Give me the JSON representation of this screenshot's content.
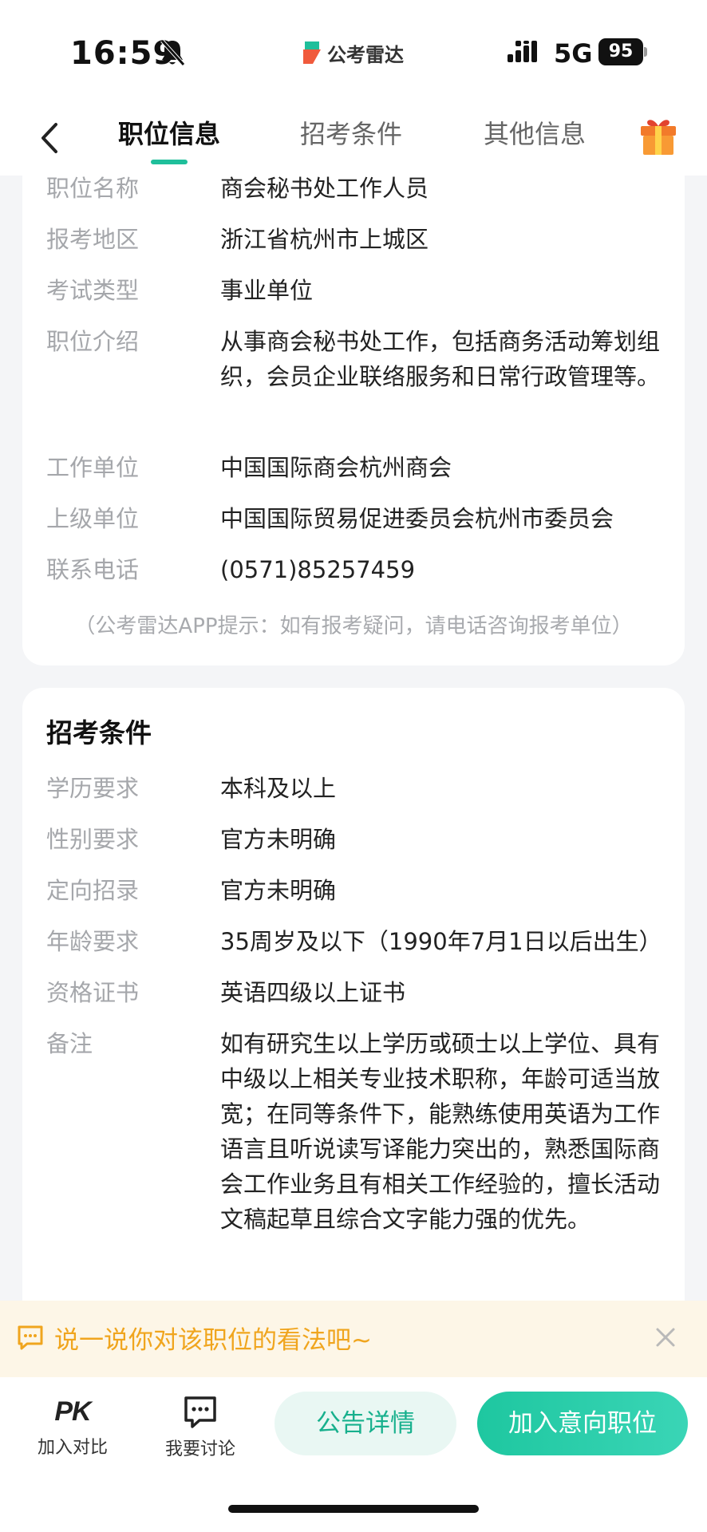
{
  "status_bar": {
    "time": "16:59",
    "network": "5G",
    "battery": "95",
    "app_logo_text": "公考雷达"
  },
  "nav": {
    "tabs": [
      {
        "label": "职位信息",
        "active": true
      },
      {
        "label": "招考条件",
        "active": false
      },
      {
        "label": "其他信息",
        "active": false
      }
    ]
  },
  "position_info": {
    "rows": [
      {
        "label": "职位名称",
        "value": "商会秘书处工作人员"
      },
      {
        "label": "报考地区",
        "value": "浙江省杭州市上城区"
      },
      {
        "label": "考试类型",
        "value": "事业单位"
      },
      {
        "label": "职位介绍",
        "value": "从事商会秘书处工作，包括商务活动筹划组织，会员企业联络服务和日常行政管理等。"
      },
      {
        "label": "工作单位",
        "value": "中国国际商会杭州商会"
      },
      {
        "label": "上级单位",
        "value": "中国国际贸易促进委员会杭州市委员会"
      },
      {
        "label": "联系电话",
        "value": "(0571)85257459"
      }
    ],
    "tip": "（公考雷达APP提示：如有报考疑问，请电话咨询报考单位）"
  },
  "requirements": {
    "title": "招考条件",
    "rows": [
      {
        "label": "学历要求",
        "value": "本科及以上"
      },
      {
        "label": "性别要求",
        "value": "官方未明确"
      },
      {
        "label": "定向招录",
        "value": "官方未明确"
      },
      {
        "label": "年龄要求",
        "value": "35周岁及以下（1990年7月1日以后出生）"
      },
      {
        "label": "资格证书",
        "value": "英语四级以上证书"
      },
      {
        "label": "备注",
        "value": "如有研究生以上学历或硕士以上学位、具有中级以上相关专业技术职称，年龄可适当放宽；在同等条件下，能熟练使用英语为工作语言且听说读写译能力突出的，熟悉国际商会工作业务且有相关工作经验的，擅长活动文稿起草且综合文字能力强的优先。"
      }
    ]
  },
  "comment_banner": {
    "prompt": "说一说你对该职位的看法吧~"
  },
  "bottom_bar": {
    "compare_mark": "PK",
    "compare_label": "加入对比",
    "discuss_label": "我要讨论",
    "notice_button": "公告详情",
    "join_button": "加入意向职位"
  },
  "colors": {
    "accent": "#1fbf9b",
    "banner_text": "#f0a51e",
    "label_gray": "#a5a7ab"
  }
}
